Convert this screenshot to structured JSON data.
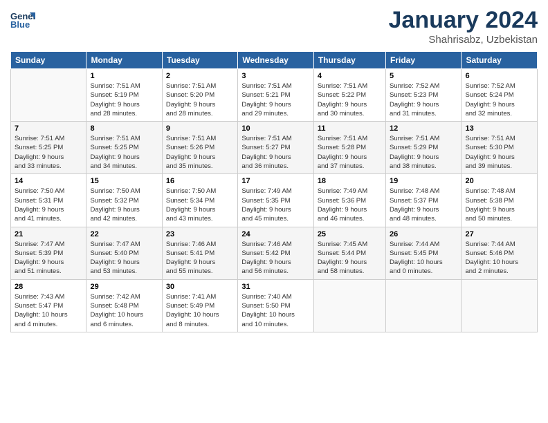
{
  "header": {
    "logo_line1": "General",
    "logo_line2": "Blue",
    "month": "January 2024",
    "location": "Shahrisabz, Uzbekistan"
  },
  "weekdays": [
    "Sunday",
    "Monday",
    "Tuesday",
    "Wednesday",
    "Thursday",
    "Friday",
    "Saturday"
  ],
  "weeks": [
    [
      {
        "day": "",
        "info": ""
      },
      {
        "day": "1",
        "info": "Sunrise: 7:51 AM\nSunset: 5:19 PM\nDaylight: 9 hours\nand 28 minutes."
      },
      {
        "day": "2",
        "info": "Sunrise: 7:51 AM\nSunset: 5:20 PM\nDaylight: 9 hours\nand 28 minutes."
      },
      {
        "day": "3",
        "info": "Sunrise: 7:51 AM\nSunset: 5:21 PM\nDaylight: 9 hours\nand 29 minutes."
      },
      {
        "day": "4",
        "info": "Sunrise: 7:51 AM\nSunset: 5:22 PM\nDaylight: 9 hours\nand 30 minutes."
      },
      {
        "day": "5",
        "info": "Sunrise: 7:52 AM\nSunset: 5:23 PM\nDaylight: 9 hours\nand 31 minutes."
      },
      {
        "day": "6",
        "info": "Sunrise: 7:52 AM\nSunset: 5:24 PM\nDaylight: 9 hours\nand 32 minutes."
      }
    ],
    [
      {
        "day": "7",
        "info": "Sunrise: 7:51 AM\nSunset: 5:25 PM\nDaylight: 9 hours\nand 33 minutes."
      },
      {
        "day": "8",
        "info": "Sunrise: 7:51 AM\nSunset: 5:25 PM\nDaylight: 9 hours\nand 34 minutes."
      },
      {
        "day": "9",
        "info": "Sunrise: 7:51 AM\nSunset: 5:26 PM\nDaylight: 9 hours\nand 35 minutes."
      },
      {
        "day": "10",
        "info": "Sunrise: 7:51 AM\nSunset: 5:27 PM\nDaylight: 9 hours\nand 36 minutes."
      },
      {
        "day": "11",
        "info": "Sunrise: 7:51 AM\nSunset: 5:28 PM\nDaylight: 9 hours\nand 37 minutes."
      },
      {
        "day": "12",
        "info": "Sunrise: 7:51 AM\nSunset: 5:29 PM\nDaylight: 9 hours\nand 38 minutes."
      },
      {
        "day": "13",
        "info": "Sunrise: 7:51 AM\nSunset: 5:30 PM\nDaylight: 9 hours\nand 39 minutes."
      }
    ],
    [
      {
        "day": "14",
        "info": "Sunrise: 7:50 AM\nSunset: 5:31 PM\nDaylight: 9 hours\nand 41 minutes."
      },
      {
        "day": "15",
        "info": "Sunrise: 7:50 AM\nSunset: 5:32 PM\nDaylight: 9 hours\nand 42 minutes."
      },
      {
        "day": "16",
        "info": "Sunrise: 7:50 AM\nSunset: 5:34 PM\nDaylight: 9 hours\nand 43 minutes."
      },
      {
        "day": "17",
        "info": "Sunrise: 7:49 AM\nSunset: 5:35 PM\nDaylight: 9 hours\nand 45 minutes."
      },
      {
        "day": "18",
        "info": "Sunrise: 7:49 AM\nSunset: 5:36 PM\nDaylight: 9 hours\nand 46 minutes."
      },
      {
        "day": "19",
        "info": "Sunrise: 7:48 AM\nSunset: 5:37 PM\nDaylight: 9 hours\nand 48 minutes."
      },
      {
        "day": "20",
        "info": "Sunrise: 7:48 AM\nSunset: 5:38 PM\nDaylight: 9 hours\nand 50 minutes."
      }
    ],
    [
      {
        "day": "21",
        "info": "Sunrise: 7:47 AM\nSunset: 5:39 PM\nDaylight: 9 hours\nand 51 minutes."
      },
      {
        "day": "22",
        "info": "Sunrise: 7:47 AM\nSunset: 5:40 PM\nDaylight: 9 hours\nand 53 minutes."
      },
      {
        "day": "23",
        "info": "Sunrise: 7:46 AM\nSunset: 5:41 PM\nDaylight: 9 hours\nand 55 minutes."
      },
      {
        "day": "24",
        "info": "Sunrise: 7:46 AM\nSunset: 5:42 PM\nDaylight: 9 hours\nand 56 minutes."
      },
      {
        "day": "25",
        "info": "Sunrise: 7:45 AM\nSunset: 5:44 PM\nDaylight: 9 hours\nand 58 minutes."
      },
      {
        "day": "26",
        "info": "Sunrise: 7:44 AM\nSunset: 5:45 PM\nDaylight: 10 hours\nand 0 minutes."
      },
      {
        "day": "27",
        "info": "Sunrise: 7:44 AM\nSunset: 5:46 PM\nDaylight: 10 hours\nand 2 minutes."
      }
    ],
    [
      {
        "day": "28",
        "info": "Sunrise: 7:43 AM\nSunset: 5:47 PM\nDaylight: 10 hours\nand 4 minutes."
      },
      {
        "day": "29",
        "info": "Sunrise: 7:42 AM\nSunset: 5:48 PM\nDaylight: 10 hours\nand 6 minutes."
      },
      {
        "day": "30",
        "info": "Sunrise: 7:41 AM\nSunset: 5:49 PM\nDaylight: 10 hours\nand 8 minutes."
      },
      {
        "day": "31",
        "info": "Sunrise: 7:40 AM\nSunset: 5:50 PM\nDaylight: 10 hours\nand 10 minutes."
      },
      {
        "day": "",
        "info": ""
      },
      {
        "day": "",
        "info": ""
      },
      {
        "day": "",
        "info": ""
      }
    ]
  ]
}
